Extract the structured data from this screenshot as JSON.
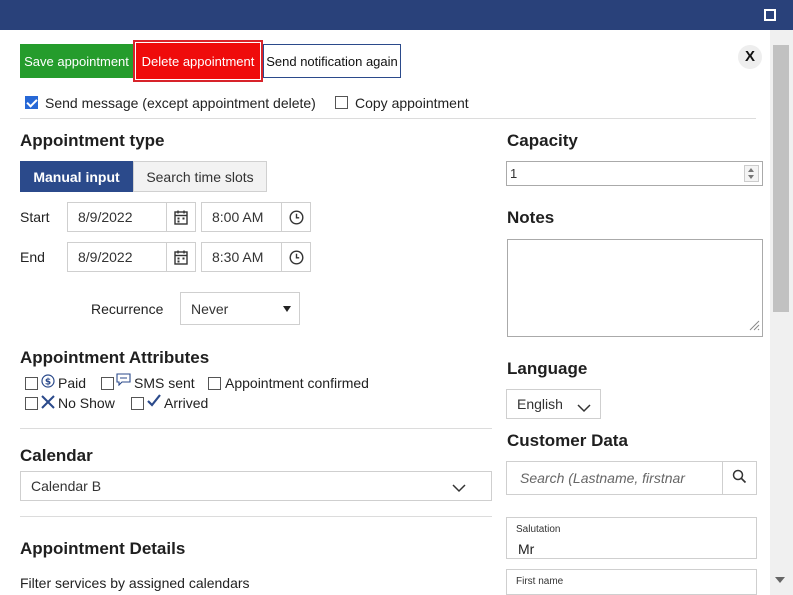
{
  "toolbar": {
    "save_label": "Save appointment",
    "delete_label": "Delete appointment",
    "notify_label": "Send notification again",
    "close_label": "X"
  },
  "options": {
    "send_message_label": "Send message (except appointment delete)",
    "send_message_checked": true,
    "copy_label": "Copy appointment",
    "copy_checked": false
  },
  "appointment_type": {
    "heading": "Appointment type",
    "manual_label": "Manual input",
    "search_label": "Search time slots",
    "start_label": "Start",
    "start_date": "8/9/2022",
    "start_time": "8:00 AM",
    "end_label": "End",
    "end_date": "8/9/2022",
    "end_time": "8:30 AM",
    "recurrence_label": "Recurrence",
    "recurrence_value": "Never"
  },
  "attributes": {
    "heading": "Appointment Attributes",
    "paid": "Paid",
    "sms_sent": "SMS sent",
    "confirmed": "Appointment confirmed",
    "no_show": "No Show",
    "arrived": "Arrived"
  },
  "calendar": {
    "heading": "Calendar",
    "value": "Calendar B"
  },
  "details": {
    "heading": "Appointment Details",
    "filter_label": "Filter services by assigned calendars"
  },
  "capacity": {
    "heading": "Capacity",
    "value": "1"
  },
  "notes": {
    "heading": "Notes"
  },
  "language": {
    "heading": "Language",
    "value": "English"
  },
  "customer": {
    "heading": "Customer Data",
    "search_placeholder": "Search (Lastname, firstnar",
    "salutation_label": "Salutation",
    "salutation_value": "Mr",
    "firstname_label": "First name"
  },
  "colors": {
    "titlebar": "#29417a",
    "save": "#259c2c",
    "delete": "#ef0b0b",
    "accent": "#2b4a8b"
  }
}
